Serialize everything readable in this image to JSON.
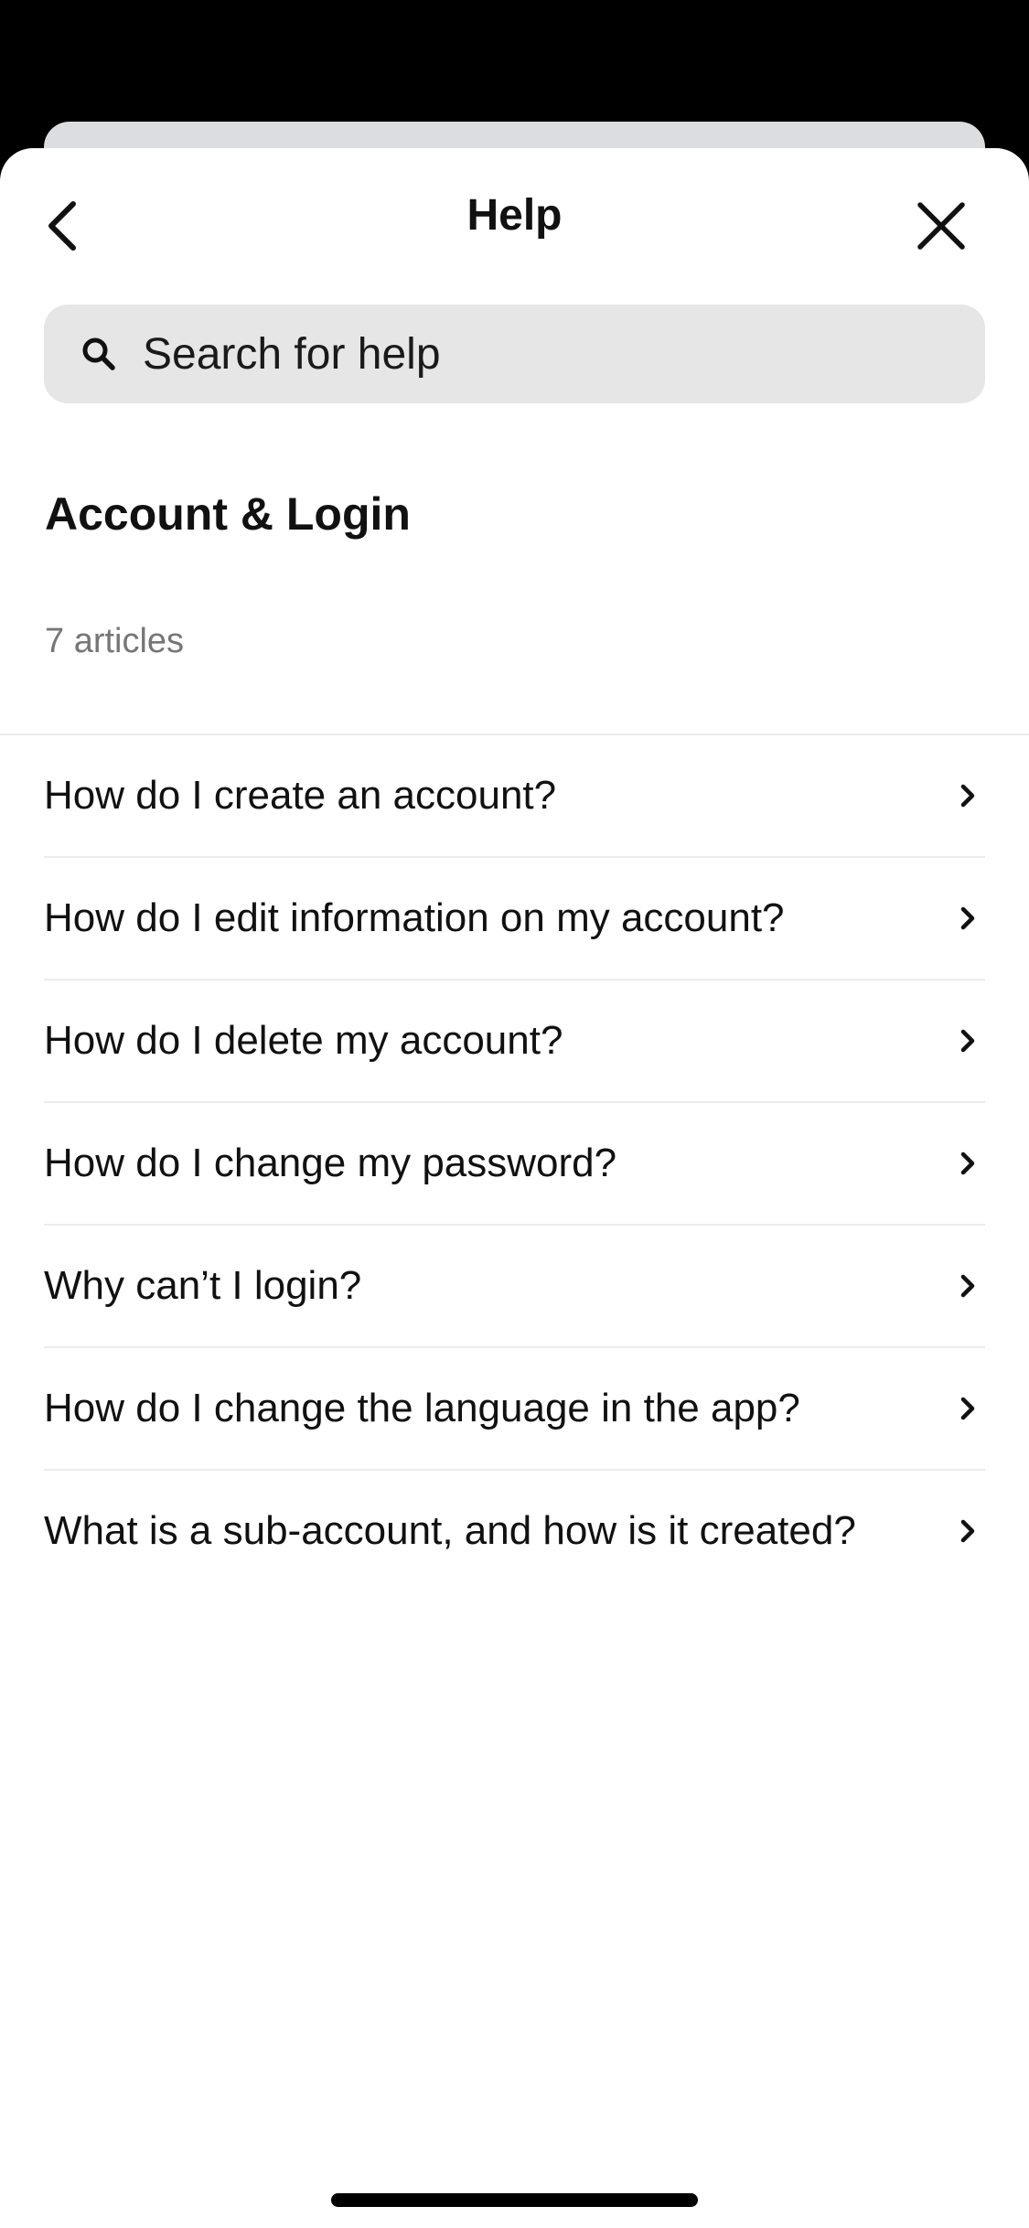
{
  "header": {
    "title": "Help",
    "back_icon": "chevron-left-icon",
    "close_icon": "close-icon"
  },
  "search": {
    "placeholder": "Search for help",
    "value": "",
    "icon": "search-icon"
  },
  "section": {
    "title": "Account & Login",
    "count_label": "7 articles"
  },
  "articles": [
    {
      "label": "How do I create an account?"
    },
    {
      "label": "How do I edit information on my account?"
    },
    {
      "label": "How do I delete my account?"
    },
    {
      "label": "How do I change my password?"
    },
    {
      "label": "Why can’t I login?"
    },
    {
      "label": "How do I change the language in the app?"
    },
    {
      "label": "What is a sub-account, and how is it created?"
    }
  ],
  "colors": {
    "background": "#000000",
    "sheet": "#ffffff",
    "search_field": "#e6e6e6",
    "text_primary": "#111111",
    "text_secondary": "#767676",
    "divider": "#ececec"
  }
}
